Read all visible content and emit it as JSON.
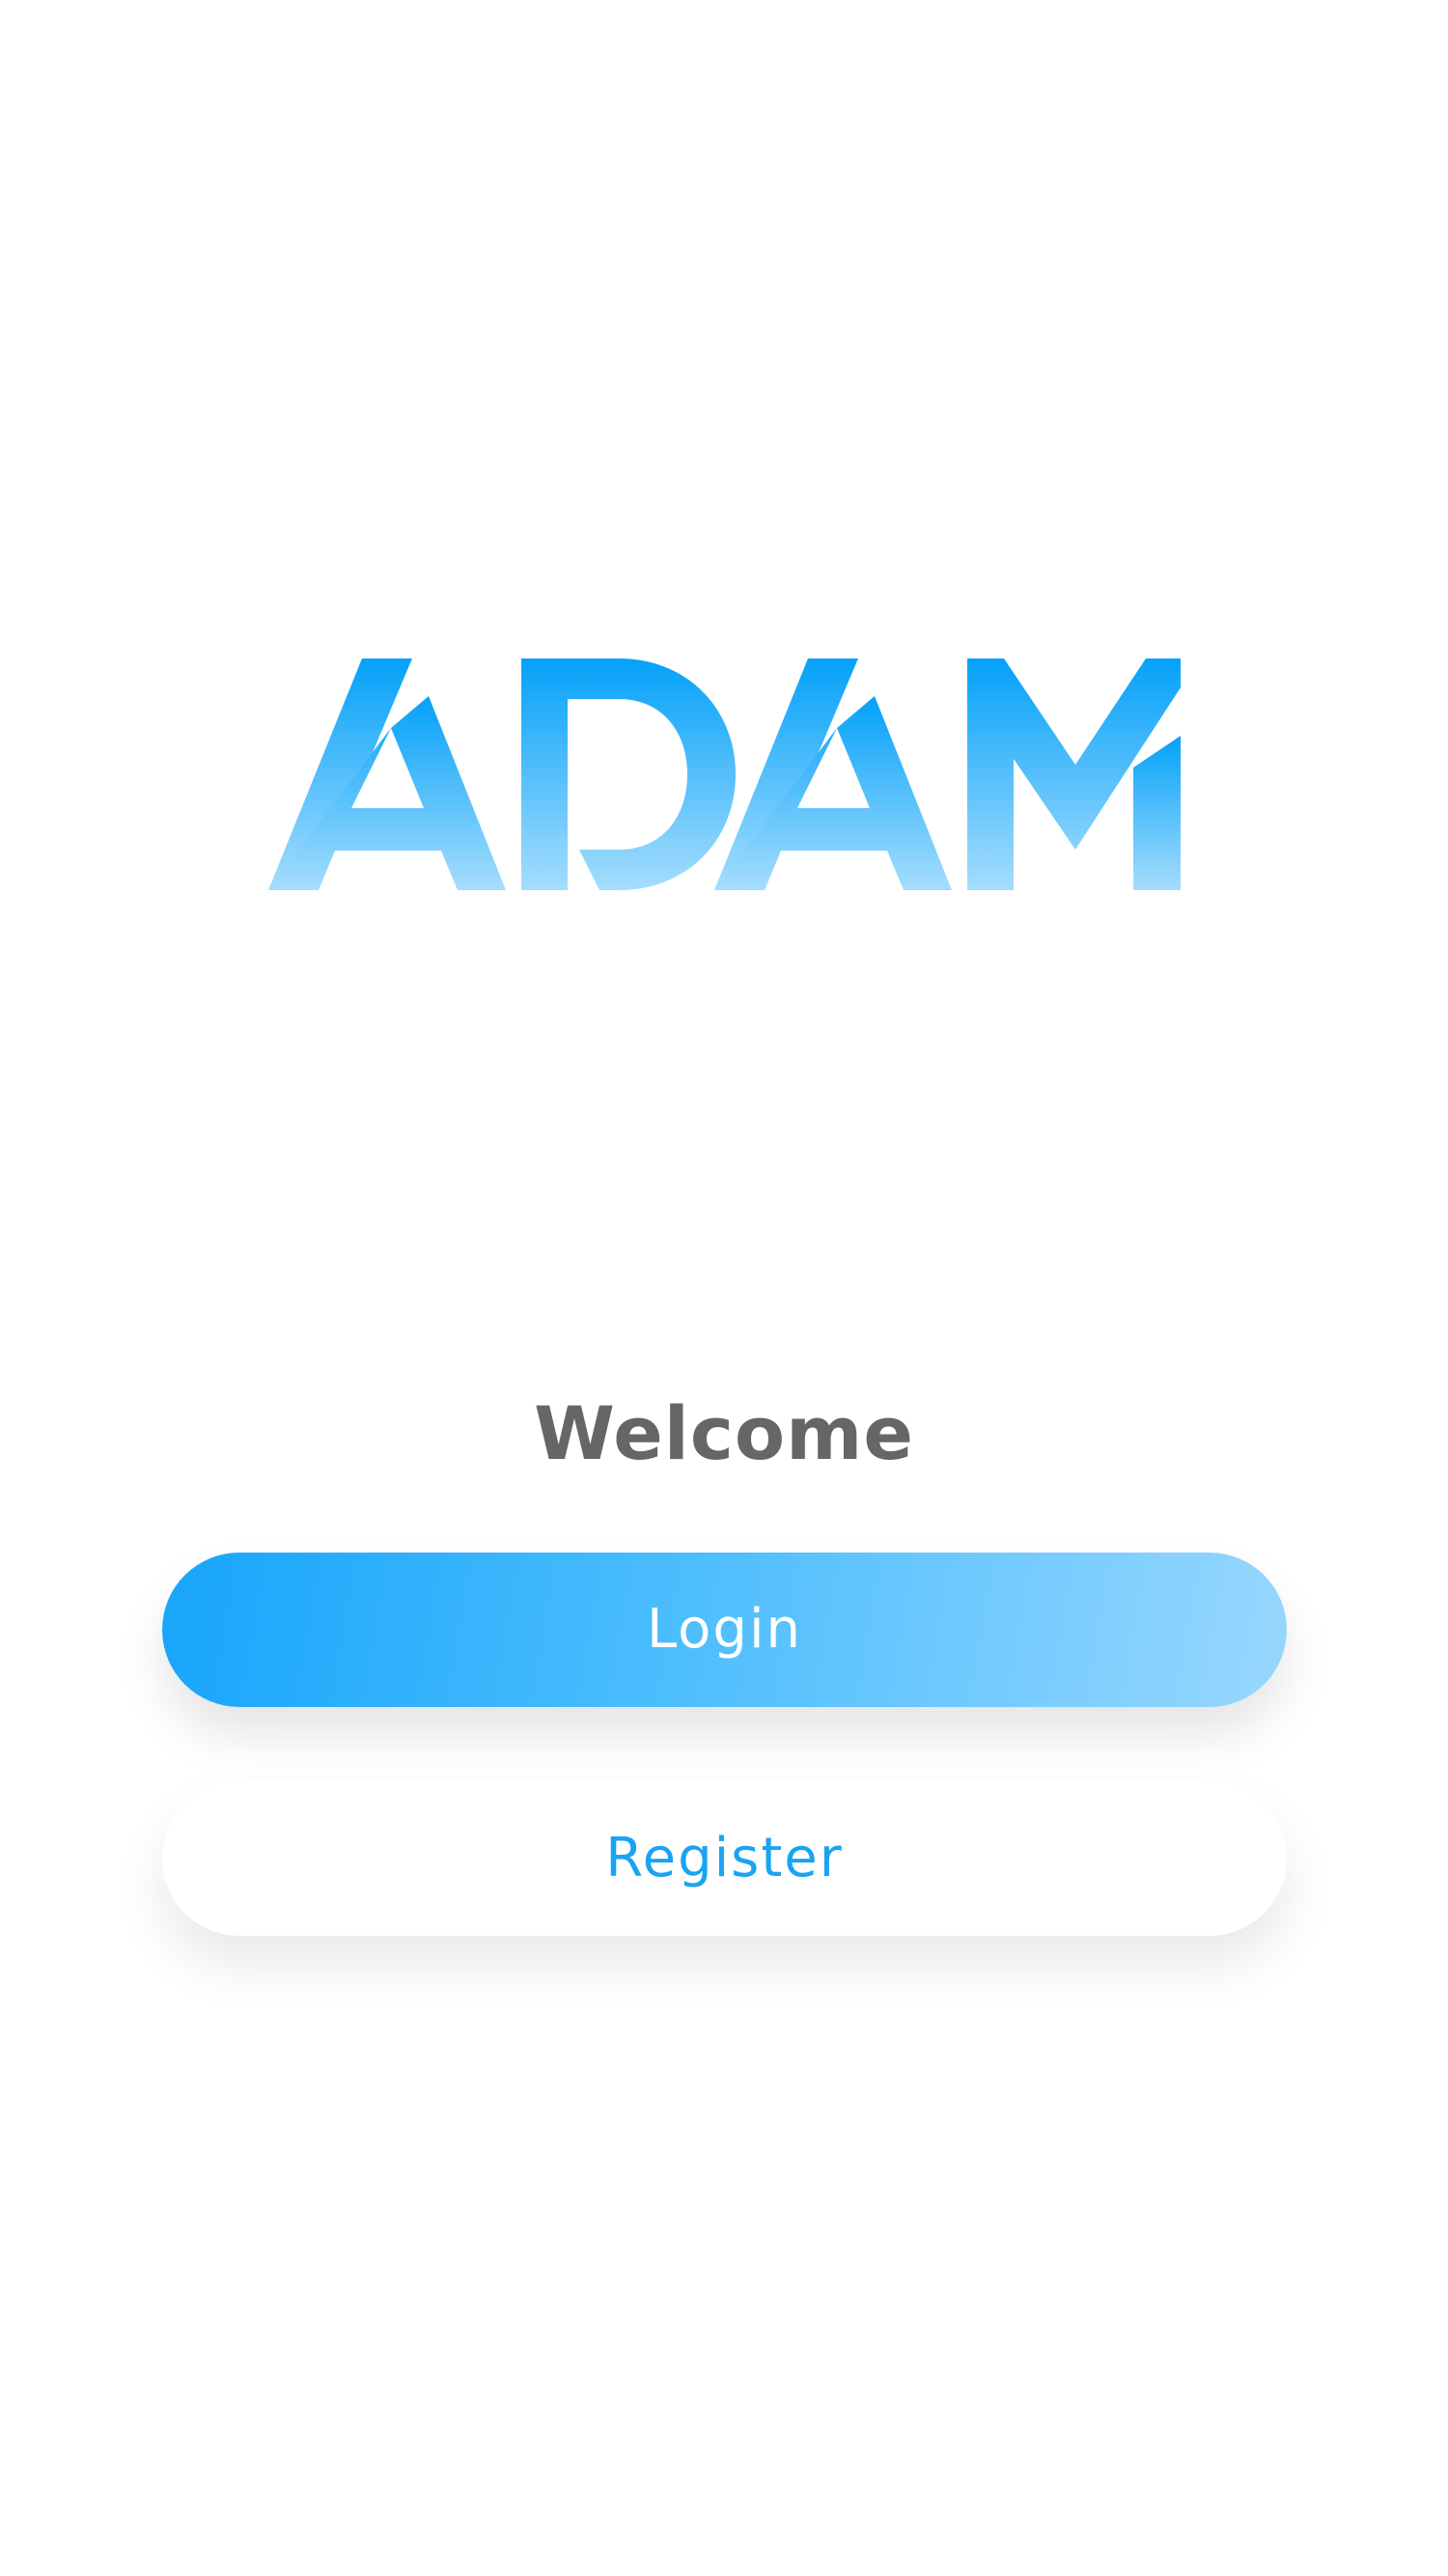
{
  "logo": {
    "text": "ADAM",
    "colors": {
      "gradient_top": "#04a1f9",
      "gradient_bottom": "#a5ddfd"
    }
  },
  "welcome": {
    "title": "Welcome"
  },
  "buttons": {
    "login_label": "Login",
    "register_label": "Register"
  },
  "colors": {
    "background": "#ffffff",
    "welcome_text": "#666666",
    "login_gradient_start": "#17a5fb",
    "login_gradient_end": "#98d7fe",
    "login_text": "#ffffff",
    "register_text": "#1aa3f3"
  }
}
